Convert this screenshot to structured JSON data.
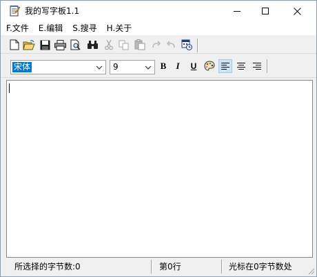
{
  "window": {
    "title": "我的写字板1.1"
  },
  "menu": {
    "items": [
      {
        "id": "file",
        "label": "F.文件"
      },
      {
        "id": "edit",
        "label": "E.编辑"
      },
      {
        "id": "search",
        "label": "S.搜寻"
      },
      {
        "id": "about",
        "label": "H.关于"
      }
    ]
  },
  "toolbar": {
    "icons": [
      "new-document-icon",
      "open-folder-icon",
      "save-icon",
      "print-icon",
      "print-preview-icon",
      "find-binoculars-icon",
      "cut-icon",
      "copy-icon",
      "paste-icon",
      "redo-icon",
      "undo-icon",
      "calendar-datetime-icon"
    ]
  },
  "format": {
    "font_name": "宋体",
    "font_size": "9",
    "bold_label": "B",
    "italic_label": "I",
    "underline_label": "U",
    "align_selected": "left"
  },
  "status": {
    "selected_bytes": "所选择的字节数:0",
    "line": "第0行",
    "cursor": "光标在0字节数处"
  },
  "colors": {
    "selection": "#0078d7",
    "active_button": "#cce4f7"
  }
}
